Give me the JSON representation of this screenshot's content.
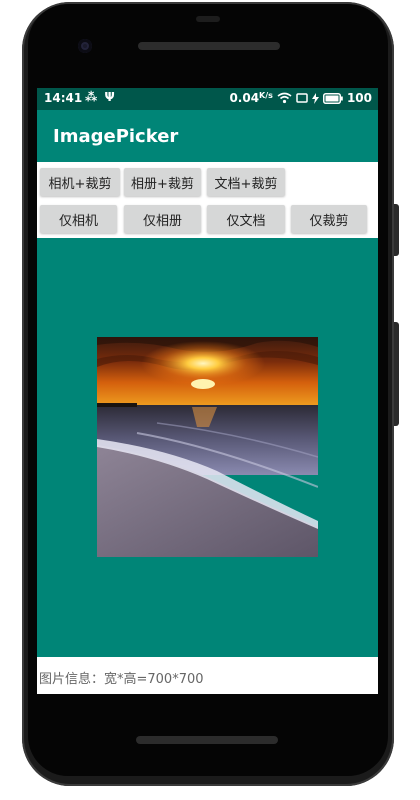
{
  "status_bar": {
    "time": "14:41",
    "left_icons": [
      "usb-tether-icon",
      "usb-icon"
    ],
    "net_speed": "0.04",
    "net_unit": "K/s",
    "battery": "100"
  },
  "app_bar": {
    "title": "ImagePicker",
    "color": "#008577",
    "status_color": "#00574b"
  },
  "buttons": {
    "row1": [
      "相机+裁剪",
      "相册+裁剪",
      "文档+裁剪"
    ],
    "row2": [
      "仅相机",
      "仅相册",
      "仅文档",
      "仅裁剪"
    ]
  },
  "image": {
    "description_icon": "sunset-beach-photo"
  },
  "info": {
    "text": "图片信息：宽*高=700*700"
  }
}
